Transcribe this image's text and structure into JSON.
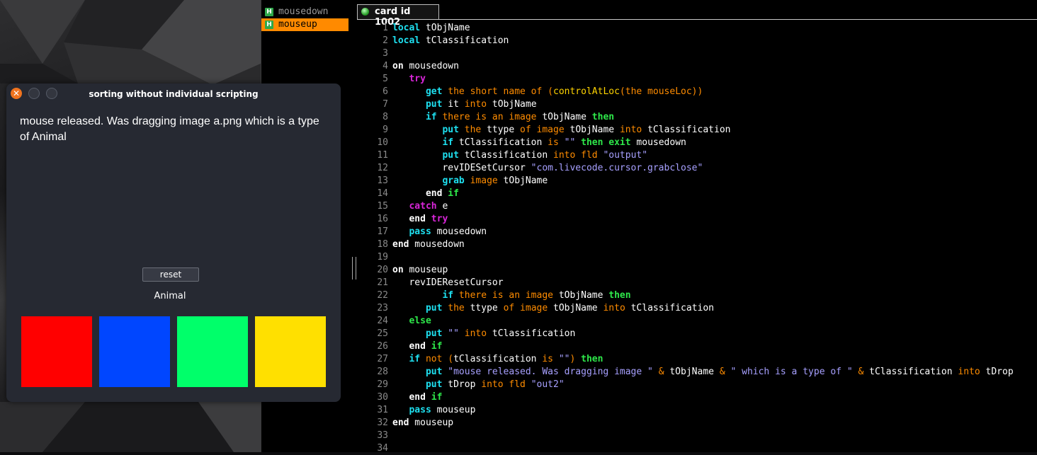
{
  "handler_list": {
    "items": [
      {
        "icon": "H",
        "label": "mousedown"
      },
      {
        "icon": "H",
        "label": "mouseup"
      }
    ],
    "selected_index": 1
  },
  "editor": {
    "tab": {
      "label": "card id 1002"
    },
    "line_numbers": [
      "1",
      "2",
      "3",
      "4",
      "5",
      "6",
      "7",
      "8",
      "9",
      "10",
      "11",
      "12",
      "13",
      "14",
      "15",
      "16",
      "17",
      "18",
      "19",
      "20",
      "21",
      "22",
      "23",
      "24",
      "25",
      "26",
      "27",
      "28",
      "29",
      "30",
      "31",
      "32",
      "33",
      "34"
    ],
    "colors": {
      "keyword_cyan": "#1ee0f0",
      "keyword_green": "#2ee84a",
      "keyword_magenta": "#d926d9",
      "operator_orange": "#ff8c00",
      "string_purple": "#a7a0ff",
      "function_yellow": "#ffd400"
    },
    "lines": [
      {
        "t": [
          [
            "kw-c",
            "local"
          ],
          [
            "id",
            " tObjName"
          ]
        ]
      },
      {
        "t": [
          [
            "kw-c",
            "local"
          ],
          [
            "id",
            " tClassification"
          ]
        ]
      },
      {
        "t": []
      },
      {
        "t": [
          [
            "kw-b",
            "on"
          ],
          [
            "id",
            " mousedown"
          ]
        ]
      },
      {
        "t": [
          [
            "id",
            "   "
          ],
          [
            "kw-m",
            "try"
          ]
        ]
      },
      {
        "t": [
          [
            "id",
            "      "
          ],
          [
            "kw-c",
            "get"
          ],
          [
            "op",
            " the short name of "
          ],
          [
            "op",
            "("
          ],
          [
            "fn",
            "controlAtLoc"
          ],
          [
            "op",
            "("
          ],
          [
            "op",
            "the mouseLoc"
          ],
          [
            "op",
            "))"
          ]
        ]
      },
      {
        "t": [
          [
            "id",
            "      "
          ],
          [
            "kw-c",
            "put"
          ],
          [
            "id",
            " it "
          ],
          [
            "op",
            "into"
          ],
          [
            "id",
            " tObjName"
          ]
        ]
      },
      {
        "t": [
          [
            "id",
            "      "
          ],
          [
            "kw-c",
            "if"
          ],
          [
            "op",
            " there is an image"
          ],
          [
            "id",
            " tObjName "
          ],
          [
            "kw-g",
            "then"
          ]
        ]
      },
      {
        "t": [
          [
            "id",
            "         "
          ],
          [
            "kw-c",
            "put"
          ],
          [
            "op",
            " the"
          ],
          [
            "id",
            " ttype "
          ],
          [
            "op",
            "of image"
          ],
          [
            "id",
            " tObjName "
          ],
          [
            "op",
            "into"
          ],
          [
            "id",
            " tClassification"
          ]
        ]
      },
      {
        "t": [
          [
            "id",
            "         "
          ],
          [
            "kw-c",
            "if"
          ],
          [
            "id",
            " tClassification "
          ],
          [
            "op",
            "is"
          ],
          [
            "str",
            " \"\" "
          ],
          [
            "kw-g",
            "then exit"
          ],
          [
            "id",
            " mousedown"
          ]
        ]
      },
      {
        "t": [
          [
            "id",
            "         "
          ],
          [
            "kw-c",
            "put"
          ],
          [
            "id",
            " tClassification "
          ],
          [
            "op",
            "into fld"
          ],
          [
            "str",
            " \"output\""
          ]
        ]
      },
      {
        "t": [
          [
            "id",
            "         revIDESetCursor "
          ],
          [
            "str",
            "\"com.livecode.cursor.grabclose\""
          ]
        ]
      },
      {
        "t": [
          [
            "id",
            "         "
          ],
          [
            "kw-c",
            "grab"
          ],
          [
            "op",
            " image"
          ],
          [
            "id",
            " tObjName"
          ]
        ]
      },
      {
        "t": [
          [
            "id",
            "      "
          ],
          [
            "kw-b",
            "end"
          ],
          [
            "kw-g",
            " if"
          ]
        ]
      },
      {
        "t": [
          [
            "id",
            "   "
          ],
          [
            "kw-m",
            "catch"
          ],
          [
            "id",
            " e"
          ]
        ]
      },
      {
        "t": [
          [
            "id",
            "   "
          ],
          [
            "kw-b",
            "end"
          ],
          [
            "kw-m",
            " try"
          ]
        ]
      },
      {
        "t": [
          [
            "id",
            "   "
          ],
          [
            "kw-c",
            "pass"
          ],
          [
            "id",
            " mousedown"
          ]
        ]
      },
      {
        "t": [
          [
            "kw-b",
            "end"
          ],
          [
            "id",
            " mousedown"
          ]
        ]
      },
      {
        "t": []
      },
      {
        "t": [
          [
            "kw-b",
            "on"
          ],
          [
            "id",
            " mouseup"
          ]
        ]
      },
      {
        "t": [
          [
            "id",
            "   revIDEResetCursor"
          ]
        ]
      },
      {
        "t": [
          [
            "id",
            "         "
          ],
          [
            "kw-c",
            "if"
          ],
          [
            "op",
            " there is an image"
          ],
          [
            "id",
            " tObjName "
          ],
          [
            "kw-g",
            "then"
          ]
        ]
      },
      {
        "t": [
          [
            "id",
            "      "
          ],
          [
            "kw-c",
            "put"
          ],
          [
            "op",
            " the"
          ],
          [
            "id",
            " ttype "
          ],
          [
            "op",
            "of image"
          ],
          [
            "id",
            " tObjName "
          ],
          [
            "op",
            "into"
          ],
          [
            "id",
            " tClassification"
          ]
        ]
      },
      {
        "t": [
          [
            "id",
            "   "
          ],
          [
            "kw-g",
            "else"
          ]
        ]
      },
      {
        "t": [
          [
            "id",
            "      "
          ],
          [
            "kw-c",
            "put"
          ],
          [
            "str",
            " \"\" "
          ],
          [
            "op",
            "into"
          ],
          [
            "id",
            " tClassification"
          ]
        ]
      },
      {
        "t": [
          [
            "id",
            "   "
          ],
          [
            "kw-b",
            "end"
          ],
          [
            "kw-g",
            " if"
          ]
        ]
      },
      {
        "t": [
          [
            "id",
            "   "
          ],
          [
            "kw-c",
            "if"
          ],
          [
            "op",
            " not ("
          ],
          [
            "id",
            "tClassification "
          ],
          [
            "op",
            "is"
          ],
          [
            "str",
            " \"\""
          ],
          [
            "op",
            ") "
          ],
          [
            "kw-g",
            "then"
          ]
        ]
      },
      {
        "t": [
          [
            "id",
            "      "
          ],
          [
            "kw-c",
            "put"
          ],
          [
            "str",
            " \"mouse released. Was dragging image \" "
          ],
          [
            "op",
            "&"
          ],
          [
            "id",
            " tObjName "
          ],
          [
            "op",
            "&"
          ],
          [
            "str",
            " \" which is a type of \" "
          ],
          [
            "op",
            "&"
          ],
          [
            "id",
            " tClassification "
          ],
          [
            "op",
            "into"
          ],
          [
            "id",
            " tDrop"
          ]
        ]
      },
      {
        "t": [
          [
            "id",
            "      "
          ],
          [
            "kw-c",
            "put"
          ],
          [
            "id",
            " tDrop "
          ],
          [
            "op",
            "into fld"
          ],
          [
            "str",
            " \"out2\""
          ]
        ]
      },
      {
        "t": [
          [
            "id",
            "   "
          ],
          [
            "kw-b",
            "end"
          ],
          [
            "kw-g",
            " if"
          ]
        ]
      },
      {
        "t": [
          [
            "id",
            "   "
          ],
          [
            "kw-c",
            "pass"
          ],
          [
            "id",
            " mouseup"
          ]
        ]
      },
      {
        "t": [
          [
            "kw-b",
            "end"
          ],
          [
            "id",
            " mouseup"
          ]
        ]
      },
      {
        "t": []
      },
      {
        "t": []
      }
    ]
  },
  "app_window": {
    "title": "sorting without individual scripting",
    "close_glyph": "✕",
    "message": "mouse released. Was dragging image a.png which is a type of Animal",
    "reset_label": "reset",
    "category": "Animal",
    "swatches": [
      {
        "name": "red-image",
        "color": "#ff0000"
      },
      {
        "name": "blue-image",
        "color": "#0046ff"
      },
      {
        "name": "green-image",
        "color": "#00ff6a"
      },
      {
        "name": "yellow-image",
        "color": "#ffe000"
      }
    ]
  }
}
